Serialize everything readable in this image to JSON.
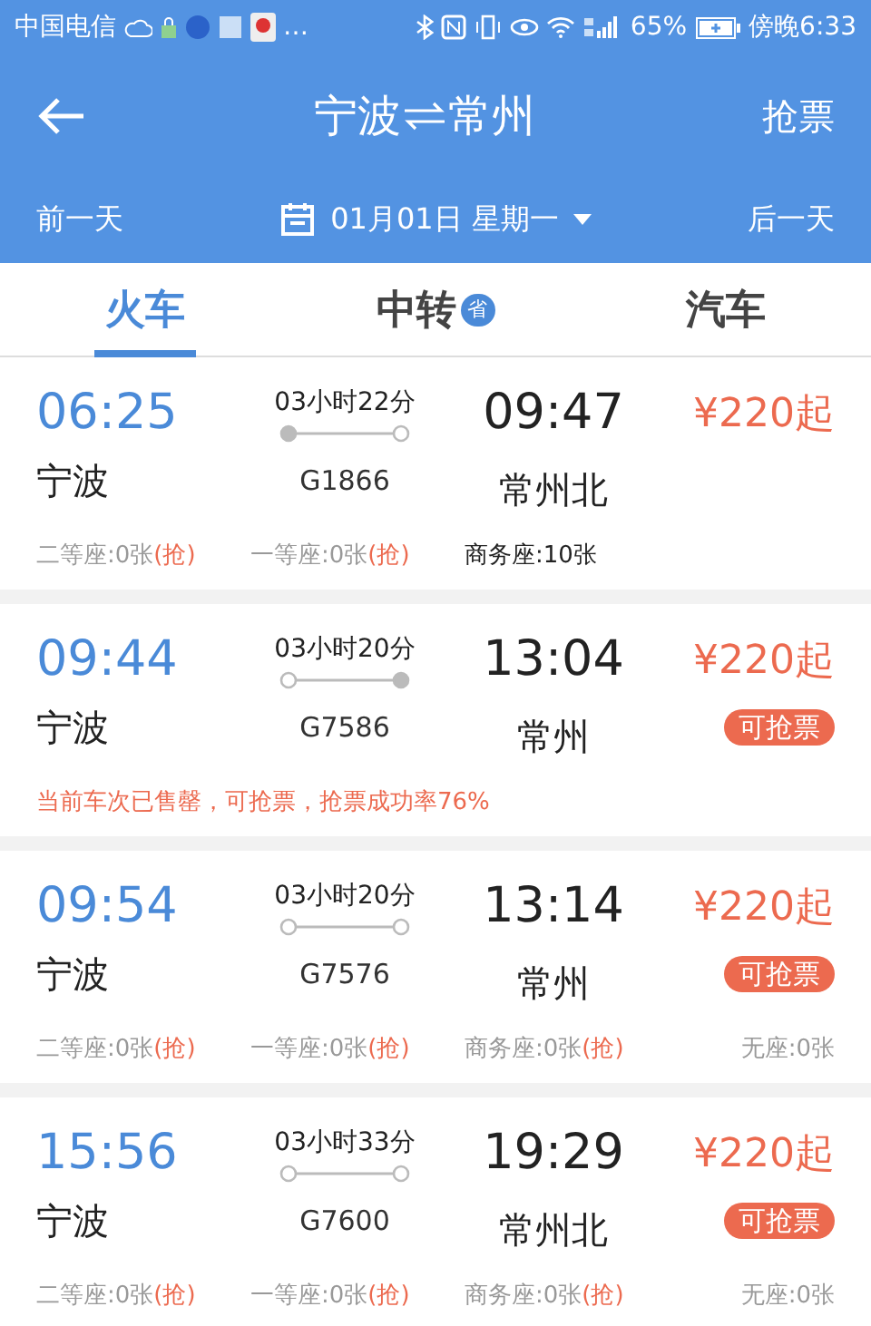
{
  "status_bar": {
    "carrier": "中国电信",
    "more": "…",
    "battery": "65%",
    "time": "傍晚6:33"
  },
  "header": {
    "from": "宁波",
    "to": "常州",
    "action": "抢票"
  },
  "date_bar": {
    "prev": "前一天",
    "date": "01月01日 星期一",
    "next": "后一天"
  },
  "tabs": [
    {
      "label": "火车",
      "selected": true
    },
    {
      "label": "中转",
      "badge": "省",
      "selected": false
    },
    {
      "label": "汽车",
      "selected": false
    }
  ],
  "trains": [
    {
      "depart": "06:25",
      "from": "宁波",
      "duration": "03小时22分",
      "number": "G1866",
      "arrive": "09:47",
      "to": "常州北",
      "price": "¥220起",
      "start_dot_filled": true,
      "end_dot_filled": false,
      "seats": [
        {
          "text": "二等座:0张",
          "grab": "(抢)"
        },
        {
          "text": "一等座:0张",
          "grab": "(抢)"
        },
        {
          "text": "商务座:10张",
          "available": true
        }
      ]
    },
    {
      "depart": "09:44",
      "from": "宁波",
      "duration": "03小时20分",
      "number": "G7586",
      "arrive": "13:04",
      "to": "常州",
      "price": "¥220起",
      "badge": "可抢票",
      "start_dot_filled": false,
      "end_dot_filled": true,
      "notice": "当前车次已售罄，可抢票，抢票成功率76%"
    },
    {
      "depart": "09:54",
      "from": "宁波",
      "duration": "03小时20分",
      "number": "G7576",
      "arrive": "13:14",
      "to": "常州",
      "price": "¥220起",
      "badge": "可抢票",
      "start_dot_filled": false,
      "end_dot_filled": false,
      "seats": [
        {
          "text": "二等座:0张",
          "grab": "(抢)"
        },
        {
          "text": "一等座:0张",
          "grab": "(抢)"
        },
        {
          "text": "商务座:0张",
          "grab": "(抢)"
        },
        {
          "text": "无座:0张"
        }
      ]
    },
    {
      "depart": "15:56",
      "from": "宁波",
      "duration": "03小时33分",
      "number": "G7600",
      "arrive": "19:29",
      "to": "常州北",
      "price": "¥220起",
      "badge": "可抢票",
      "start_dot_filled": false,
      "end_dot_filled": false,
      "seats": [
        {
          "text": "二等座:0张",
          "grab": "(抢)"
        },
        {
          "text": "一等座:0张",
          "grab": "(抢)"
        },
        {
          "text": "商务座:0张",
          "grab": "(抢)"
        },
        {
          "text": "无座:0张"
        }
      ]
    }
  ]
}
